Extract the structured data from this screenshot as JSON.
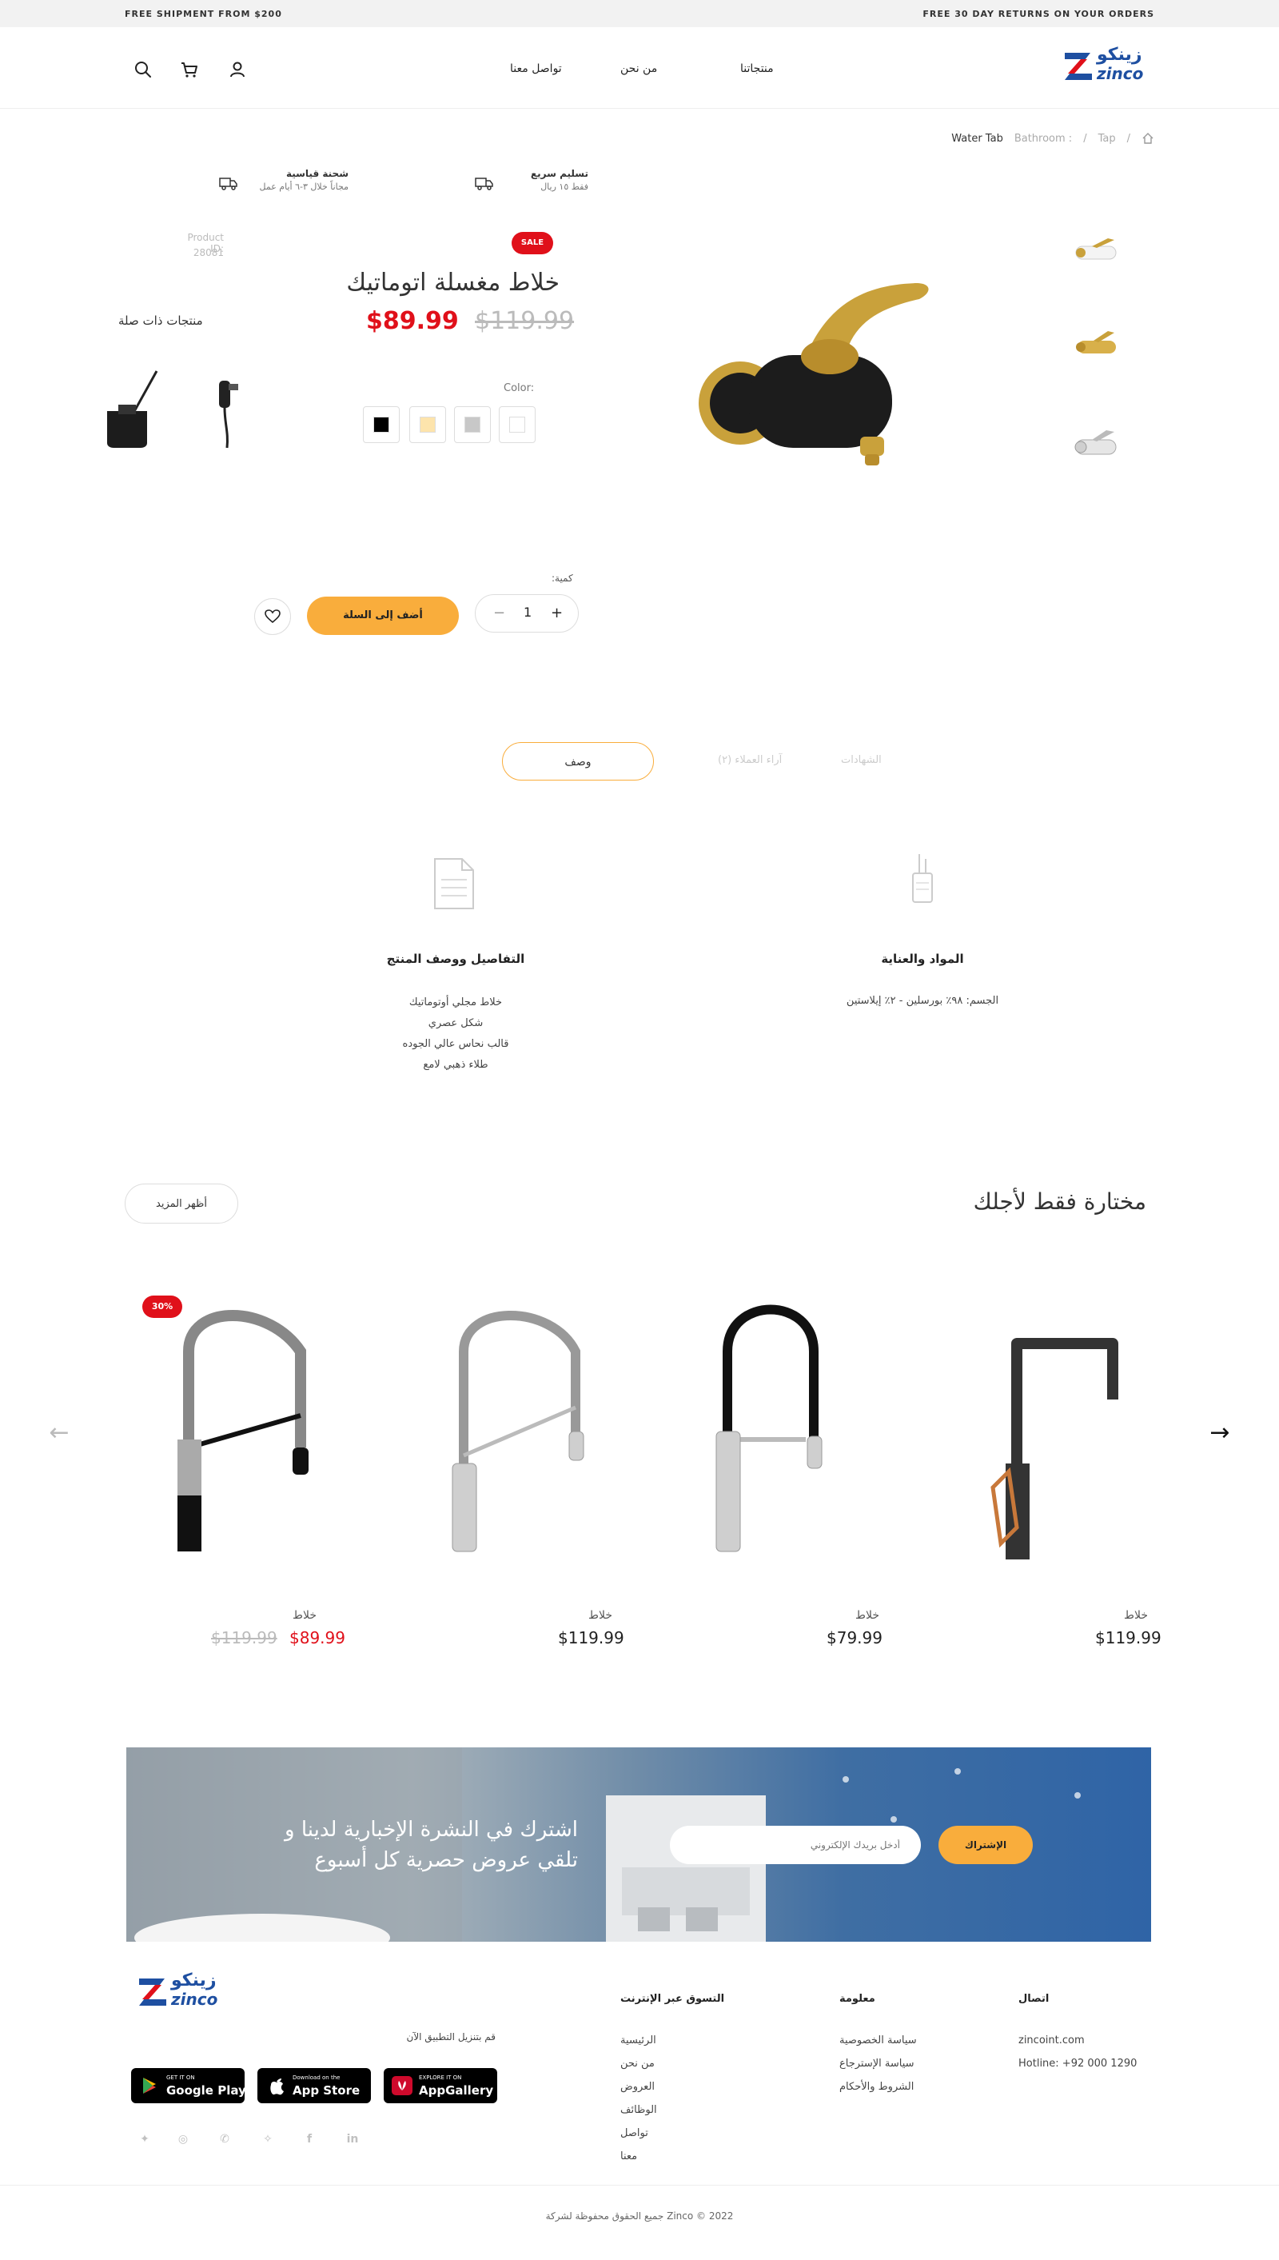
{
  "topbar": {
    "left": "FREE SHIPMENT FROM $200",
    "right": "FREE 30 DAY RETURNS ON YOUR ORDERS"
  },
  "header": {
    "logo_ar": "زينكو",
    "logo_en": "zinco",
    "nav": [
      "منتجاتنا",
      "من نحن",
      "تواصل معنا"
    ]
  },
  "breadcrumb": [
    "Tap",
    "Bathroom :",
    "Water Tab"
  ],
  "info": {
    "fast_title": "تسليم سريع",
    "fast_sub": "فقط ١٥ ريال",
    "free_title": "شحنة قياسية",
    "free_sub": "مجاناً خلال ٣-٦ أيام عمل"
  },
  "product": {
    "sale": "SALE",
    "title": "خلاط مغسلة اتوماتيك",
    "price_new": "$89.99",
    "price_old": "$119.99",
    "color_label": "Color:",
    "colors": [
      "#000000",
      "#fde4ac",
      "#c8c8c8",
      "#ffffff"
    ],
    "id_label": "Product ID:",
    "id_value": "28081",
    "related_title": "منتجات ذات صلة",
    "qty_label": "كمية:",
    "qty": "1",
    "add_to_cart": "أضف إلى السلة"
  },
  "tabs": {
    "description": "وصف",
    "reviews": "آراء العملاء (٢)",
    "certificates": "الشهادات"
  },
  "desc": {
    "materials_title": "المواد والعناية",
    "materials_line": "الجسم: ٩٨٪ بورسلين - ٢٪ إيلاستين",
    "details_title": "التفاصيل ووصف المنتج",
    "details_lines": [
      "خلاط مجلي أوتوماتيك",
      "شكل عصري",
      "قالب نحاس عالي الجوده",
      "طلاء ذهبي لامع"
    ]
  },
  "featured": {
    "title": "مختارة فقط لأجلك",
    "show_more": "أظهر المزيد",
    "discount": "30%",
    "cards": [
      {
        "name": "خلاط",
        "price": "$89.99",
        "old": "$119.99"
      },
      {
        "name": "خلاط",
        "price": "$119.99"
      },
      {
        "name": "خلاط",
        "price": "$79.99"
      },
      {
        "name": "خلاط",
        "price": "$119.99"
      }
    ]
  },
  "newsletter": {
    "text_1": "اشترك في النشرة الإخبارية لدينا و",
    "text_2": "تلقي عروض حصرية كل أسبوع",
    "placeholder": "أدخل بريدك الإلكتروني",
    "button": "الإشتراك"
  },
  "footer": {
    "download": "قم بتنزيل التطبيق الآن",
    "stores": [
      {
        "small": "GET IT ON",
        "big": "Google Play"
      },
      {
        "small": "Download on the",
        "big": "App Store"
      },
      {
        "small": "EXPLORE IT ON",
        "big": "AppGallery"
      }
    ],
    "shop_title": "التسوق عبر الإنترنت",
    "shop_links": [
      "الرئيسية",
      "من نحن",
      "العروض",
      "الوظائف",
      "تواصل",
      "معنا"
    ],
    "info_title": "معلومة",
    "info_links": [
      "سياسة الخصوصية",
      "سياسة الإسترجاع",
      "الشروط والأحكام"
    ],
    "contact_title": "اتصال",
    "email": "zincoint.com",
    "hotline": "Hotline: +92 000 1290",
    "copyright": "2022 © Zinco جميع الحقوق محفوظة لشركة"
  },
  "colors": {
    "accent": "#f9ad3c",
    "sale_red": "#e0101a",
    "brand_blue": "#1e4fa1"
  }
}
